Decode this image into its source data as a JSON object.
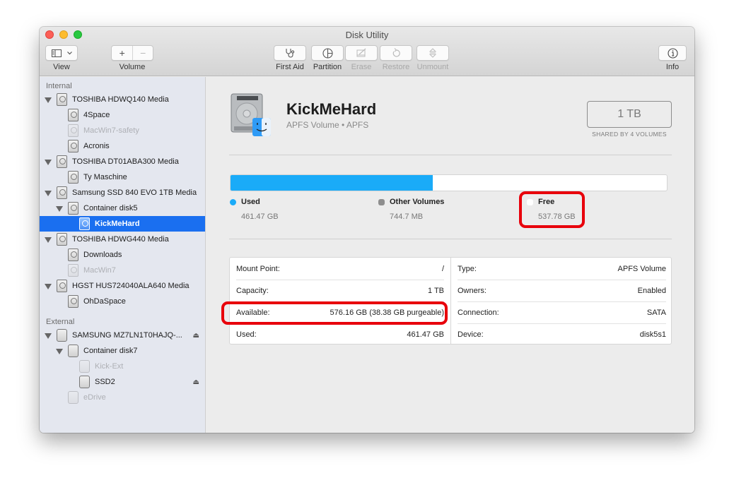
{
  "window": {
    "title": "Disk Utility"
  },
  "toolbar": {
    "view_label": "View",
    "volume_label": "Volume",
    "volume_add": "+",
    "volume_remove": "−",
    "first_aid_label": "First Aid",
    "partition_label": "Partition",
    "erase_label": "Erase",
    "restore_label": "Restore",
    "unmount_label": "Unmount",
    "info_label": "Info",
    "icons": {
      "view": "sidebar-icon",
      "first_aid": "stethoscope-icon",
      "partition": "pie-icon",
      "erase": "erase-icon",
      "restore": "restore-icon",
      "unmount": "unmount-icon",
      "info": "info-icon"
    }
  },
  "sidebar": {
    "internal_header": "Internal",
    "external_header": "External",
    "items": [
      {
        "label": "TOSHIBA HDWQ140 Media",
        "level": 0,
        "expanded": true,
        "state": "normal",
        "kind": "hdd"
      },
      {
        "label": "4Space",
        "level": 1,
        "state": "normal",
        "kind": "hdd"
      },
      {
        "label": "MacWin7-safety",
        "level": 1,
        "state": "dim",
        "kind": "hdd"
      },
      {
        "label": "Acronis",
        "level": 1,
        "state": "normal",
        "kind": "hdd"
      },
      {
        "label": "TOSHIBA DT01ABA300 Media",
        "level": 0,
        "expanded": true,
        "state": "normal",
        "kind": "hdd"
      },
      {
        "label": "Ty Maschine",
        "level": 1,
        "state": "normal",
        "kind": "hdd"
      },
      {
        "label": "Samsung SSD 840 EVO 1TB Media",
        "level": 0,
        "expanded": true,
        "state": "normal",
        "kind": "hdd"
      },
      {
        "label": "Container disk5",
        "level": 1,
        "expanded": true,
        "state": "normal",
        "kind": "hdd"
      },
      {
        "label": "KickMeHard",
        "level": 2,
        "state": "selected",
        "kind": "hdd"
      },
      {
        "label": "TOSHIBA HDWG440 Media",
        "level": 0,
        "expanded": true,
        "state": "normal",
        "kind": "hdd"
      },
      {
        "label": "Downloads",
        "level": 1,
        "state": "normal",
        "kind": "hdd"
      },
      {
        "label": "MacWin7",
        "level": 1,
        "state": "dim",
        "kind": "hdd"
      },
      {
        "label": "HGST HUS724040ALA640 Media",
        "level": 0,
        "expanded": true,
        "state": "normal",
        "kind": "hdd"
      },
      {
        "label": "OhDaSpace",
        "level": 1,
        "state": "normal",
        "kind": "hdd"
      }
    ],
    "external_items": [
      {
        "label": "SAMSUNG MZ7LN1T0HAJQ-...",
        "level": 0,
        "expanded": true,
        "state": "normal",
        "kind": "external",
        "eject": true
      },
      {
        "label": "Container disk7",
        "level": 1,
        "expanded": true,
        "state": "normal",
        "kind": "external"
      },
      {
        "label": "Kick-Ext",
        "level": 2,
        "state": "dim",
        "kind": "external"
      },
      {
        "label": "SSD2",
        "level": 2,
        "state": "normal",
        "kind": "external",
        "eject": true
      },
      {
        "label": "eDrive",
        "level": 1,
        "state": "dim",
        "kind": "external"
      }
    ],
    "eject_glyph": "⏏"
  },
  "volume": {
    "name": "KickMeHard",
    "subtitle": "APFS Volume • APFS",
    "capacity": "1 TB",
    "capacity_note": "SHARED BY 4 VOLUMES"
  },
  "usage": {
    "used_fraction": 0.464,
    "colors": {
      "used": "#1aabf8",
      "other": "#8e8e8e",
      "free": "#ffffff"
    },
    "legend": [
      {
        "title": "Used",
        "value": "461.47 GB"
      },
      {
        "title": "Other Volumes",
        "value": "744.7 MB"
      },
      {
        "title": "Free",
        "value": "537.78 GB"
      }
    ]
  },
  "details": {
    "left": [
      {
        "key": "Mount Point:",
        "value": "/"
      },
      {
        "key": "Capacity:",
        "value": "1 TB"
      },
      {
        "key": "Available:",
        "value": "576.16 GB (38.38 GB purgeable)"
      },
      {
        "key": "Used:",
        "value": "461.47 GB"
      }
    ],
    "right": [
      {
        "key": "Type:",
        "value": "APFS Volume"
      },
      {
        "key": "Owners:",
        "value": "Enabled"
      },
      {
        "key": "Connection:",
        "value": "SATA"
      },
      {
        "key": "Device:",
        "value": "disk5s1"
      }
    ]
  },
  "annotations": {
    "highlight_color": "#e8000b",
    "highlighted": [
      "Free",
      "Available:"
    ]
  }
}
